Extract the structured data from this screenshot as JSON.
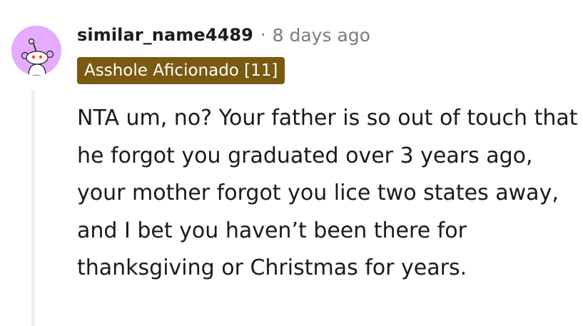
{
  "comment": {
    "author": "similar_name4489",
    "separator": "·",
    "timestamp": "8 days ago",
    "flair": "Asshole Aficionado [11]",
    "body": "NTA um, no? Your father is so out of touch that he forgot you graduated over 3 years ago, your mother forgot you lice two states away, and I bet you haven’t been there for thanksgiving or Christmas for years."
  },
  "avatar": {
    "icon": "snoo-avatar-icon",
    "background_color": "#e4abff"
  },
  "colors": {
    "flair_background": "#7a5a10",
    "meta_text": "#7c7c7c",
    "thread_line": "#edeff1"
  }
}
